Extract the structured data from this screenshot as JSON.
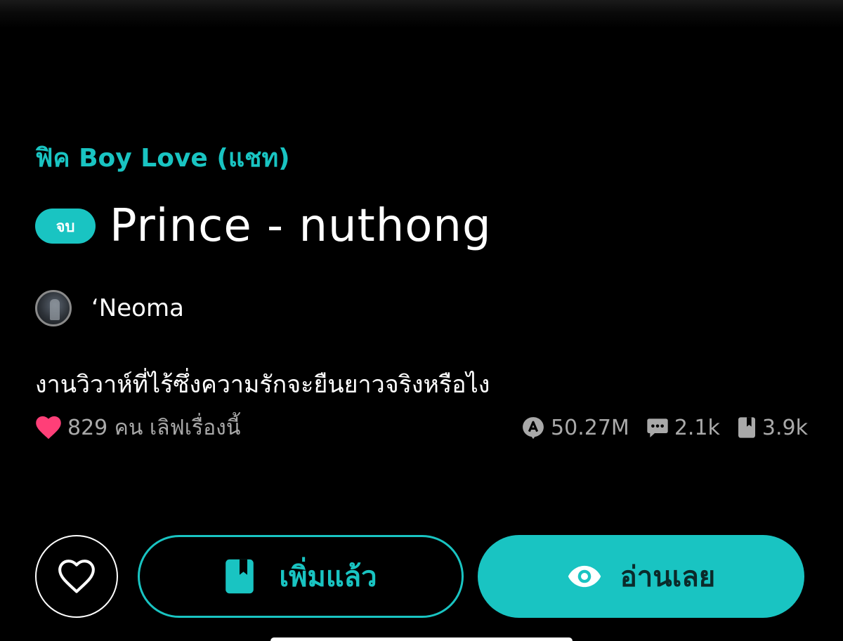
{
  "story": {
    "category": "ฟิค Boy Love (แชท)",
    "status_badge": "จบ",
    "title": "Prince - nuthong",
    "author": "‘Neoma",
    "synopsis": "งานวิวาห์ที่ไร้ซึ่งความรักจะยืนยาวจริงหรือไง"
  },
  "stats": {
    "likes_text": "829 คน เลิฟเรื่องนี้",
    "views": "50.27M",
    "comments": "2.1k",
    "bookmarks": "3.9k"
  },
  "actions": {
    "added_label": "เพิ่มแล้ว",
    "read_label": "อ่านเลย"
  },
  "icons": {
    "heart_filled": "heart-filled-icon",
    "views": "views-icon",
    "comments": "comment-icon",
    "bookmark": "bookmark-icon",
    "heart_outline": "heart-outline-icon",
    "eye": "eye-icon"
  },
  "colors": {
    "accent": "#19c4c2",
    "like_pink": "#ff3f78",
    "muted_text": "#a9a9a9",
    "background": "#000000"
  }
}
